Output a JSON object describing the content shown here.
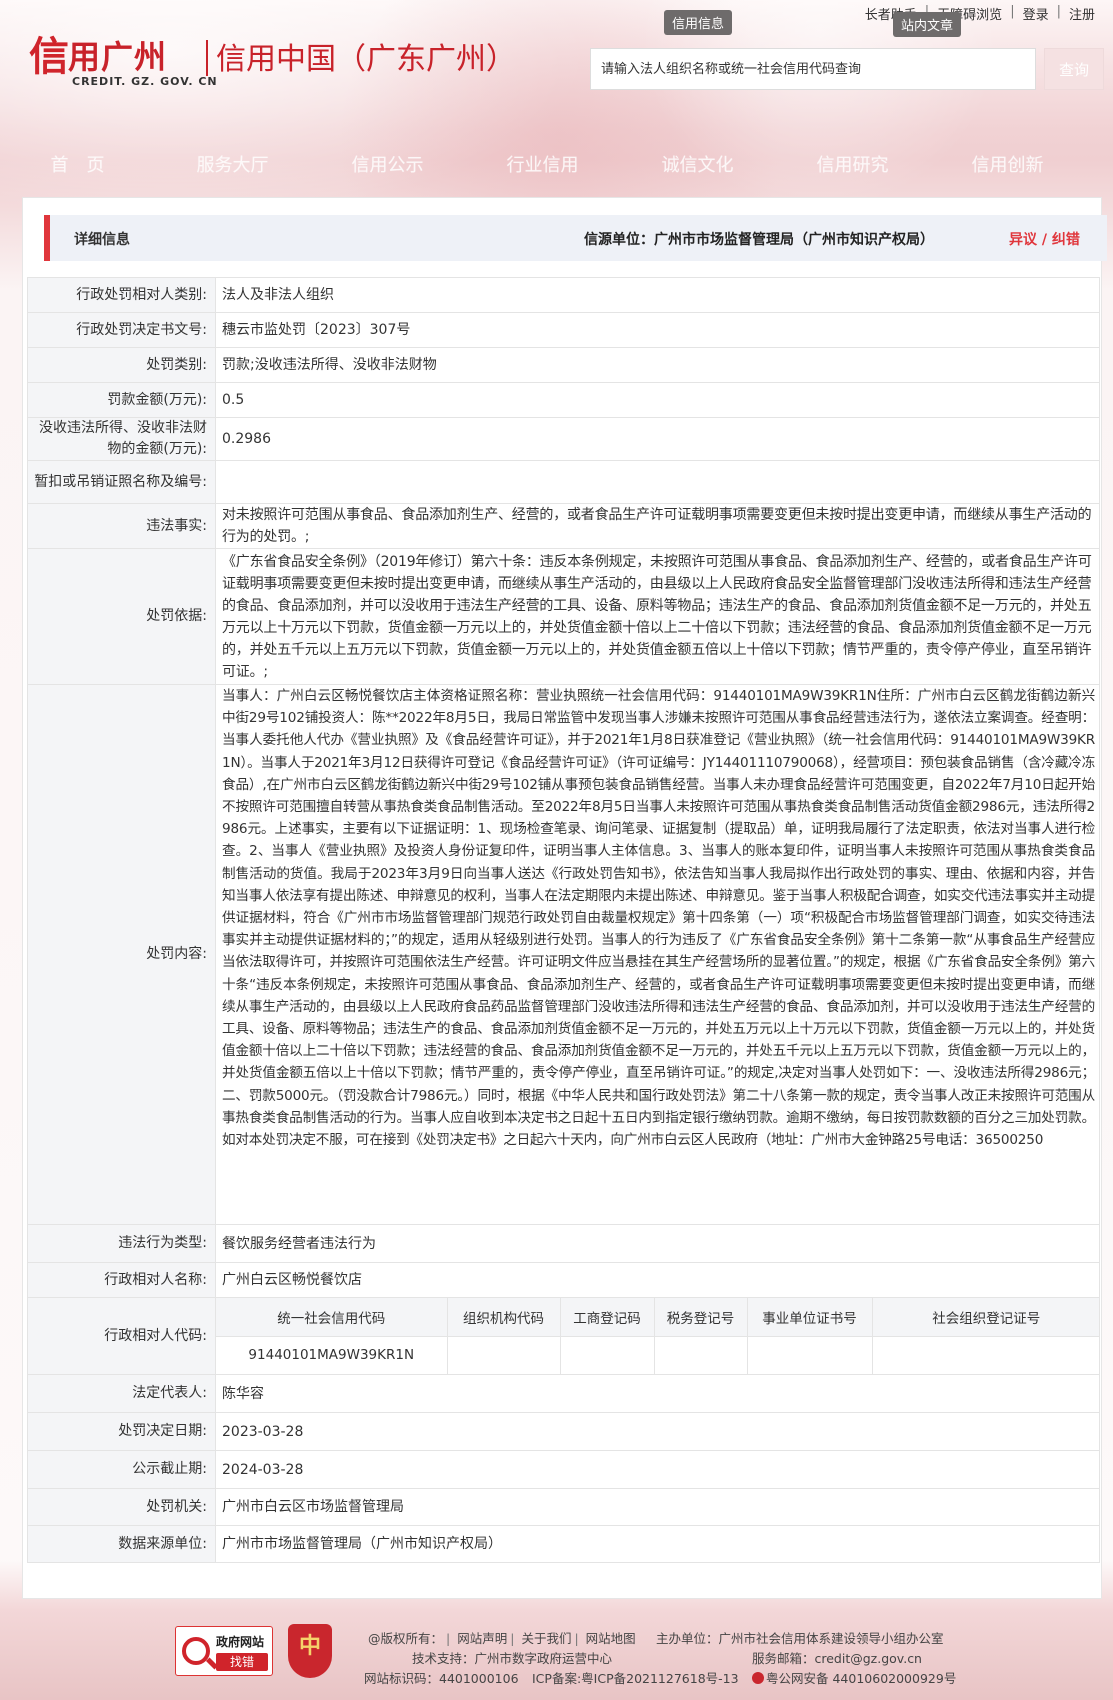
{
  "header": {
    "top_links": {
      "elder": "长者助手",
      "accessible": "无障碍浏览",
      "login": "登录",
      "register": "注册"
    },
    "bubbles": {
      "credit_info": "信用信息",
      "site_search": "站内文章"
    },
    "logo": {
      "mark": "信",
      "main": "用广州",
      "sub": "信用中国（广东广州）",
      "en": "CREDIT. GZ. GOV. CN"
    },
    "search": {
      "placeholder": "请输入法人组织名称或统一社会信用代码查询",
      "button": "查询"
    }
  },
  "nav": [
    "首　页",
    "服务大厅",
    "信用公示",
    "行业信用",
    "诚信文化",
    "信用研究",
    "信用创新"
  ],
  "detail": {
    "title": "详细信息",
    "source": "信源单位：广州市市场监督管理局（广州市知识产权局）",
    "dispute": "异议 / 纠错"
  },
  "rows": {
    "subject_type": {
      "label": "行政处罚相对人类别:",
      "value": "法人及非法人组织"
    },
    "decision_no": {
      "label": "行政处罚决定书文号:",
      "value": "穗云市监处罚〔2023〕307号"
    },
    "penalty_type": {
      "label": "处罚类别:",
      "value": "罚款;没收违法所得、没收非法财物"
    },
    "fine_amount": {
      "label": "罚款金额(万元):",
      "value": "0.5"
    },
    "confiscated_amount": {
      "label": "没收违法所得、没收非法财物的金额(万元):",
      "value": "0.2986"
    },
    "license_suspend": {
      "label": "暂扣或吊销证照名称及编号:",
      "value": ""
    },
    "illegal_facts": {
      "label": "违法事实:",
      "value": "对未按照许可范围从事食品、食品添加剂生产、经营的，或者食品生产许可证载明事项需要变更但未按时提出变更申请，而继续从事生产活动的行为的处罚。;"
    },
    "penalty_basis": {
      "label": "处罚依据:",
      "value": "《广东省食品安全条例》（2019年修订）第六十条：违反本条例规定，未按照许可范围从事食品、食品添加剂生产、经营的，或者食品生产许可证载明事项需要变更但未按时提出变更申请，而继续从事生产活动的，由县级以上人民政府食品安全监督管理部门没收违法所得和违法生产经营的食品、食品添加剂，并可以没收用于违法生产经营的工具、设备、原料等物品；违法生产的食品、食品添加剂货值金额不足一万元的，并处五万元以上十万元以下罚款，货值金额一万元以上的，并处货值金额十倍以上二十倍以下罚款；违法经营的食品、食品添加剂货值金额不足一万元的，并处五千元以上五万元以下罚款，货值金额一万元以上的，并处货值金额五倍以上十倍以下罚款；情节严重的，责令停产停业，直至吊销许可证。;"
    },
    "penalty_content": {
      "label": "处罚内容:",
      "value": "当事人：广州白云区畅悦餐饮店主体资格证照名称：营业执照统一社会信用代码：91440101MA9W39KR1N住所：广州市白云区鹤龙街鹤边新兴中街29号102铺投资人：陈**2022年8月5日，我局日常监管中发现当事人涉嫌未按照许可范围从事食品经营违法行为，遂依法立案调查。经查明：当事人委托他人代办《营业执照》及《食品经营许可证》，并于2021年1月8日获准登记《营业执照》（统一社会信用代码：91440101MA9W39KR1N）。当事人于2021年3月12日获得许可登记《食品经营许可证》（许可证编号：JY14401110790068），经营项目：预包装食品销售（含冷藏冷冻食品）,在广州市白云区鹤龙街鹤边新兴中街29号102铺从事预包装食品销售经营。当事人未办理食品经营许可范围变更，自2022年7月10日起开始不按照许可范围擅自转营从事热食类食品制售活动。至2022年8月5日当事人未按照许可范围从事热食类食品制售活动货值金额2986元，违法所得2986元。上述事实，主要有以下证据证明：1、现场检查笔录、询问笔录、证据复制（提取品）单，证明我局履行了法定职责，依法对当事人进行检查。2、当事人《营业执照》及投资人身份证复印件，证明当事人主体信息。3、当事人的账本复印件，证明当事人未按照许可范围从事热食类食品制售活动的货值。我局于2023年3月9日向当事人送达《行政处罚告知书》，依法告知当事人我局拟作出行政处罚的事实、理由、依据和内容，并告知当事人依法享有提出陈述、申辩意见的权利，当事人在法定期限内未提出陈述、申辩意见。鉴于当事人积极配合调查，如实交代违法事实并主动提供证据材料，符合《广州市市场监督管理部门规范行政处罚自由裁量权规定》第十四条第（一）项“积极配合市场监督管理部门调查，如实交待违法事实并主动提供证据材料的；”的规定，适用从轻级别进行处罚。当事人的行为违反了《广东省食品安全条例》第十二条第一款“从事食品生产经营应当依法取得许可，并按照许可范围依法生产经营。许可证明文件应当悬挂在其生产经营场所的显著位置。”的规定，根据《广东省食品安全条例》第六十条“违反本条例规定，未按照许可范围从事食品、食品添加剂生产、经营的，或者食品生产许可证载明事项需要变更但未按时提出变更申请，而继续从事生产活动的，由县级以上人民政府食品药品监督管理部门没收违法所得和违法生产经营的食品、食品添加剂，并可以没收用于违法生产经营的工具、设备、原料等物品；违法生产的食品、食品添加剂货值金额不足一万元的，并处五万元以上十万元以下罚款，货值金额一万元以上的，并处货值金额十倍以上二十倍以下罚款；违法经营的食品、食品添加剂货值金额不足一万元的，并处五千元以上五万元以下罚款，货值金额一万元以上的，并处货值金额五倍以上十倍以下罚款；情节严重的，责令停产停业，直至吊销许可证。”的规定,决定对当事人处罚如下：一、没收违法所得2986元；二、罚款5000元。（罚没款合计7986元。）同时，根据《中华人民共和国行政处罚法》第二十八条第一款的规定，责令当事人改正未按照许可范围从事热食类食品制售活动的行为。当事人应自收到本决定书之日起十五日内到指定银行缴纳罚款。逾期不缴纳，每日按罚款数额的百分之三加处罚款。如对本处罚决定不服，可在接到《处罚决定书》之日起六十天内，向广州市白云区人民政府（地址：广州市大金钟路25号电话：36500250"
    },
    "violation_type": {
      "label": "违法行为类型:",
      "value": "餐饮服务经营者违法行为"
    },
    "subject_name": {
      "label": "行政相对人名称:",
      "value": "广州白云区畅悦餐饮店"
    },
    "subject_code": {
      "label": "行政相对人代码:",
      "headers": [
        "统一社会信用代码",
        "组织机构代码",
        "工商登记码",
        "税务登记号",
        "事业单位证书号",
        "社会组织登记证号"
      ],
      "values": [
        "91440101MA9W39KR1N",
        "",
        "",
        "",
        "",
        ""
      ]
    },
    "legal_rep": {
      "label": "法定代表人:",
      "value": "陈华容"
    },
    "decision_date": {
      "label": "处罚决定日期:",
      "value": "2023-03-28"
    },
    "publish_deadline": {
      "label": "公示截止期:",
      "value": "2024-03-28"
    },
    "authority": {
      "label": "处罚机关:",
      "value": "广州市白云区市场监督管理局"
    },
    "data_source": {
      "label": "数据来源单位:",
      "value": "广州市市场监督管理局（广州市知识产权局）"
    }
  },
  "footer": {
    "gov_badge": {
      "title": "政府网站",
      "action": "找错"
    },
    "shield_mark": "中",
    "links": [
      "@版权所有：",
      "网站声明",
      "关于我们",
      "网站地图"
    ],
    "host": "主办单位：广州市社会信用体系建设领导小组办公室",
    "tech": "技术支持：广州市数字政府运营中心",
    "email": "服务邮箱：credit@gz.gov.cn",
    "site_id": "网站标识码：4401000106",
    "icp": "ICP备案:粤ICP备2021127618号-13",
    "police": "粤公网安备 44010602000929号"
  },
  "colors": {
    "brand_red": "#c8222a",
    "accent_red": "#e0363c",
    "label_bg": "#f4f5f7",
    "header_bg": "#eef1f7"
  }
}
